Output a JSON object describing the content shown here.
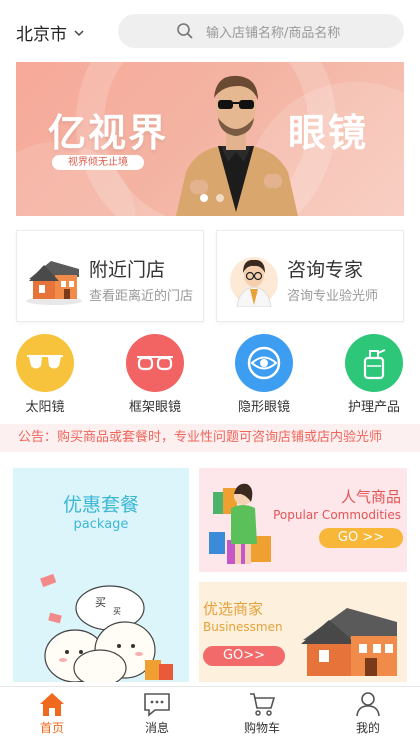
{
  "header": {
    "city": "北京市",
    "search_placeholder": "输入店铺名称/商品名称"
  },
  "banner": {
    "title_left": "亿视界",
    "title_right": "眼镜",
    "tagline": "视界倾无止境",
    "slides": 2,
    "active_slide": 1
  },
  "features": [
    {
      "title": "附近门店",
      "subtitle": "查看距离近的门店"
    },
    {
      "title": "咨询专家",
      "subtitle": "咨询专业验光师"
    }
  ],
  "categories": [
    {
      "label": "太阳镜",
      "color": "#f7c23c",
      "icon": "sunglasses-icon"
    },
    {
      "label": "框架眼镜",
      "color": "#f26464",
      "icon": "glasses-frame-icon"
    },
    {
      "label": "隐形眼镜",
      "color": "#3d9df0",
      "icon": "contact-lens-icon"
    },
    {
      "label": "护理产品",
      "color": "#2ec77a",
      "icon": "care-bottle-icon"
    }
  ],
  "notice": "公告：购买商品或套餐时，专业性问题可咨询店铺或店内验光师",
  "promos": {
    "package": {
      "title": "优惠套餐",
      "subtitle": "package"
    },
    "popular": {
      "title": "人气商品",
      "subtitle": "Popular Commodities",
      "button": "GO >>"
    },
    "merchant": {
      "title": "优选商家",
      "subtitle": "Businessmen",
      "button": "GO>>"
    }
  },
  "tabbar": [
    {
      "label": "首页",
      "icon": "home-icon",
      "active": true
    },
    {
      "label": "消息",
      "icon": "message-icon",
      "active": false
    },
    {
      "label": "购物车",
      "icon": "cart-icon",
      "active": false
    },
    {
      "label": "我的",
      "icon": "user-icon",
      "active": false
    }
  ],
  "colors": {
    "accent": "#ef6a1e",
    "notice_text": "#f0645a",
    "package_text": "#3cb7d6"
  }
}
